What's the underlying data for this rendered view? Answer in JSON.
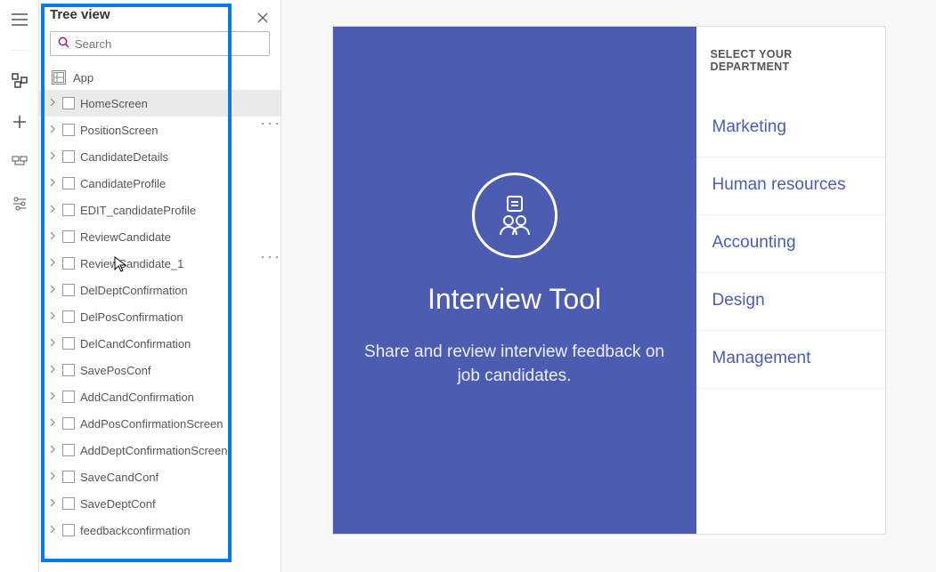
{
  "panel_title": "Tree view",
  "search_placeholder": "Search",
  "app_node": "App",
  "screens": [
    {
      "name": "HomeScreen",
      "selected": true
    },
    {
      "name": "PositionScreen"
    },
    {
      "name": "CandidateDetails"
    },
    {
      "name": "CandidateProfile"
    },
    {
      "name": "EDIT_candidateProfile"
    },
    {
      "name": "ReviewCandidate",
      "cursor": true,
      "showdots": true
    },
    {
      "name": "ReviewCandidate_1"
    },
    {
      "name": "DelDeptConfirmation"
    },
    {
      "name": "DelPosConfirmation"
    },
    {
      "name": "DelCandConfirmation"
    },
    {
      "name": "SavePosConf"
    },
    {
      "name": "AddCandConfirmation"
    },
    {
      "name": "AddPosConfirmationScreen"
    },
    {
      "name": "AddDeptConfirmationScreen"
    },
    {
      "name": "SaveCandConf"
    },
    {
      "name": "SaveDeptConf"
    },
    {
      "name": "feedbackconfirmation"
    }
  ],
  "preview": {
    "title": "Interview Tool",
    "subtitle": "Share and review interview feedback on job candidates.",
    "dept_header": "SELECT YOUR DEPARTMENT",
    "departments": [
      "Marketing",
      "Human resources",
      "Accounting",
      "Design",
      "Management"
    ]
  }
}
